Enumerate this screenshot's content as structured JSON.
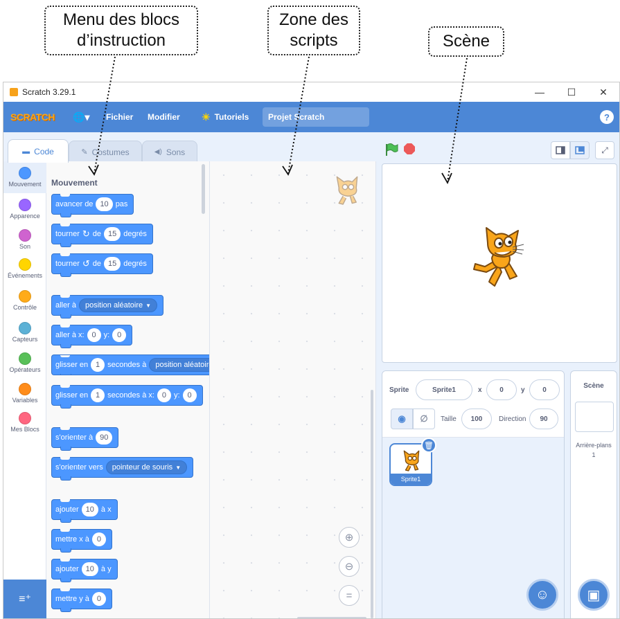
{
  "annotations": {
    "menu_line1": "Menu des blocs",
    "menu_line2": "d’instruction",
    "scripts_line1": "Zone des",
    "scripts_line2": "scripts",
    "stage": "Scène"
  },
  "window": {
    "title": "Scratch 3.29.1",
    "minimize": "—",
    "maximize": "☐",
    "close": "✕"
  },
  "menubar": {
    "logo": "SCRATCH",
    "globe": "🌐▾",
    "file": "Fichier",
    "edit": "Modifier",
    "tutorials": "Tutoriels",
    "project_title": "Projet Scratch",
    "help": "?"
  },
  "tabs": {
    "code": "Code",
    "costumes": "Costumes",
    "sounds": "Sons"
  },
  "categories": [
    {
      "label": "Mouvement",
      "color": "#4c97ff"
    },
    {
      "label": "Apparence",
      "color": "#9966ff"
    },
    {
      "label": "Son",
      "color": "#cf63cf"
    },
    {
      "label": "Événements",
      "color": "#ffd500"
    },
    {
      "label": "Contrôle",
      "color": "#ffab19"
    },
    {
      "label": "Capteurs",
      "color": "#5cb1d6"
    },
    {
      "label": "Opérateurs",
      "color": "#59c059"
    },
    {
      "label": "Variables",
      "color": "#ff8c1a"
    },
    {
      "label": "Mes Blocs",
      "color": "#ff6680"
    }
  ],
  "palette": {
    "heading": "Mouvement",
    "b1": {
      "pre": "avancer de",
      "v1": "10",
      "post": "pas"
    },
    "b2": {
      "pre": "tourner",
      "icon": "↻",
      "mid": "de",
      "v1": "15",
      "post": "degrés"
    },
    "b3": {
      "pre": "tourner",
      "icon": "↺",
      "mid": "de",
      "v1": "15",
      "post": "degrés"
    },
    "b4": {
      "pre": "aller à",
      "drop": "position aléatoire"
    },
    "b5": {
      "pre": "aller à x:",
      "v1": "0",
      "mid": "y:",
      "v2": "0"
    },
    "b6": {
      "pre": "glisser en",
      "v1": "1",
      "mid": "secondes à",
      "drop": "position aléatoire"
    },
    "b7": {
      "pre": "glisser en",
      "v1": "1",
      "mid": "secondes à x:",
      "v2": "0",
      "mid2": "y:",
      "v3": "0"
    },
    "b8": {
      "pre": "s'orienter à",
      "v1": "90"
    },
    "b9": {
      "pre": "s'orienter vers",
      "drop": "pointeur de souris"
    },
    "b10": {
      "pre": "ajouter",
      "v1": "10",
      "post": "à x"
    },
    "b11": {
      "pre": "mettre x à",
      "v1": "0"
    },
    "b12": {
      "pre": "ajouter",
      "v1": "10",
      "post": "à y"
    },
    "b13": {
      "pre": "mettre y à",
      "v1": "0"
    }
  },
  "zoom": {
    "in": "⊕",
    "out": "⊖",
    "reset": "="
  },
  "sprite_info": {
    "sprite_label": "Sprite",
    "sprite_name": "Sprite1",
    "x_label": "x",
    "x_value": "0",
    "y_label": "y",
    "y_value": "0",
    "size_label": "Taille",
    "size_value": "100",
    "direction_label": "Direction",
    "direction_value": "90"
  },
  "sprite_list": [
    {
      "name": "Sprite1"
    }
  ],
  "backdrop": {
    "title": "Scène",
    "label": "Arrière-plans",
    "count": "1"
  },
  "colors": {
    "menubar": "#4c87d6",
    "motion": "#4c97ff",
    "flag": "#4cbf56",
    "stop": "#ec5959"
  }
}
